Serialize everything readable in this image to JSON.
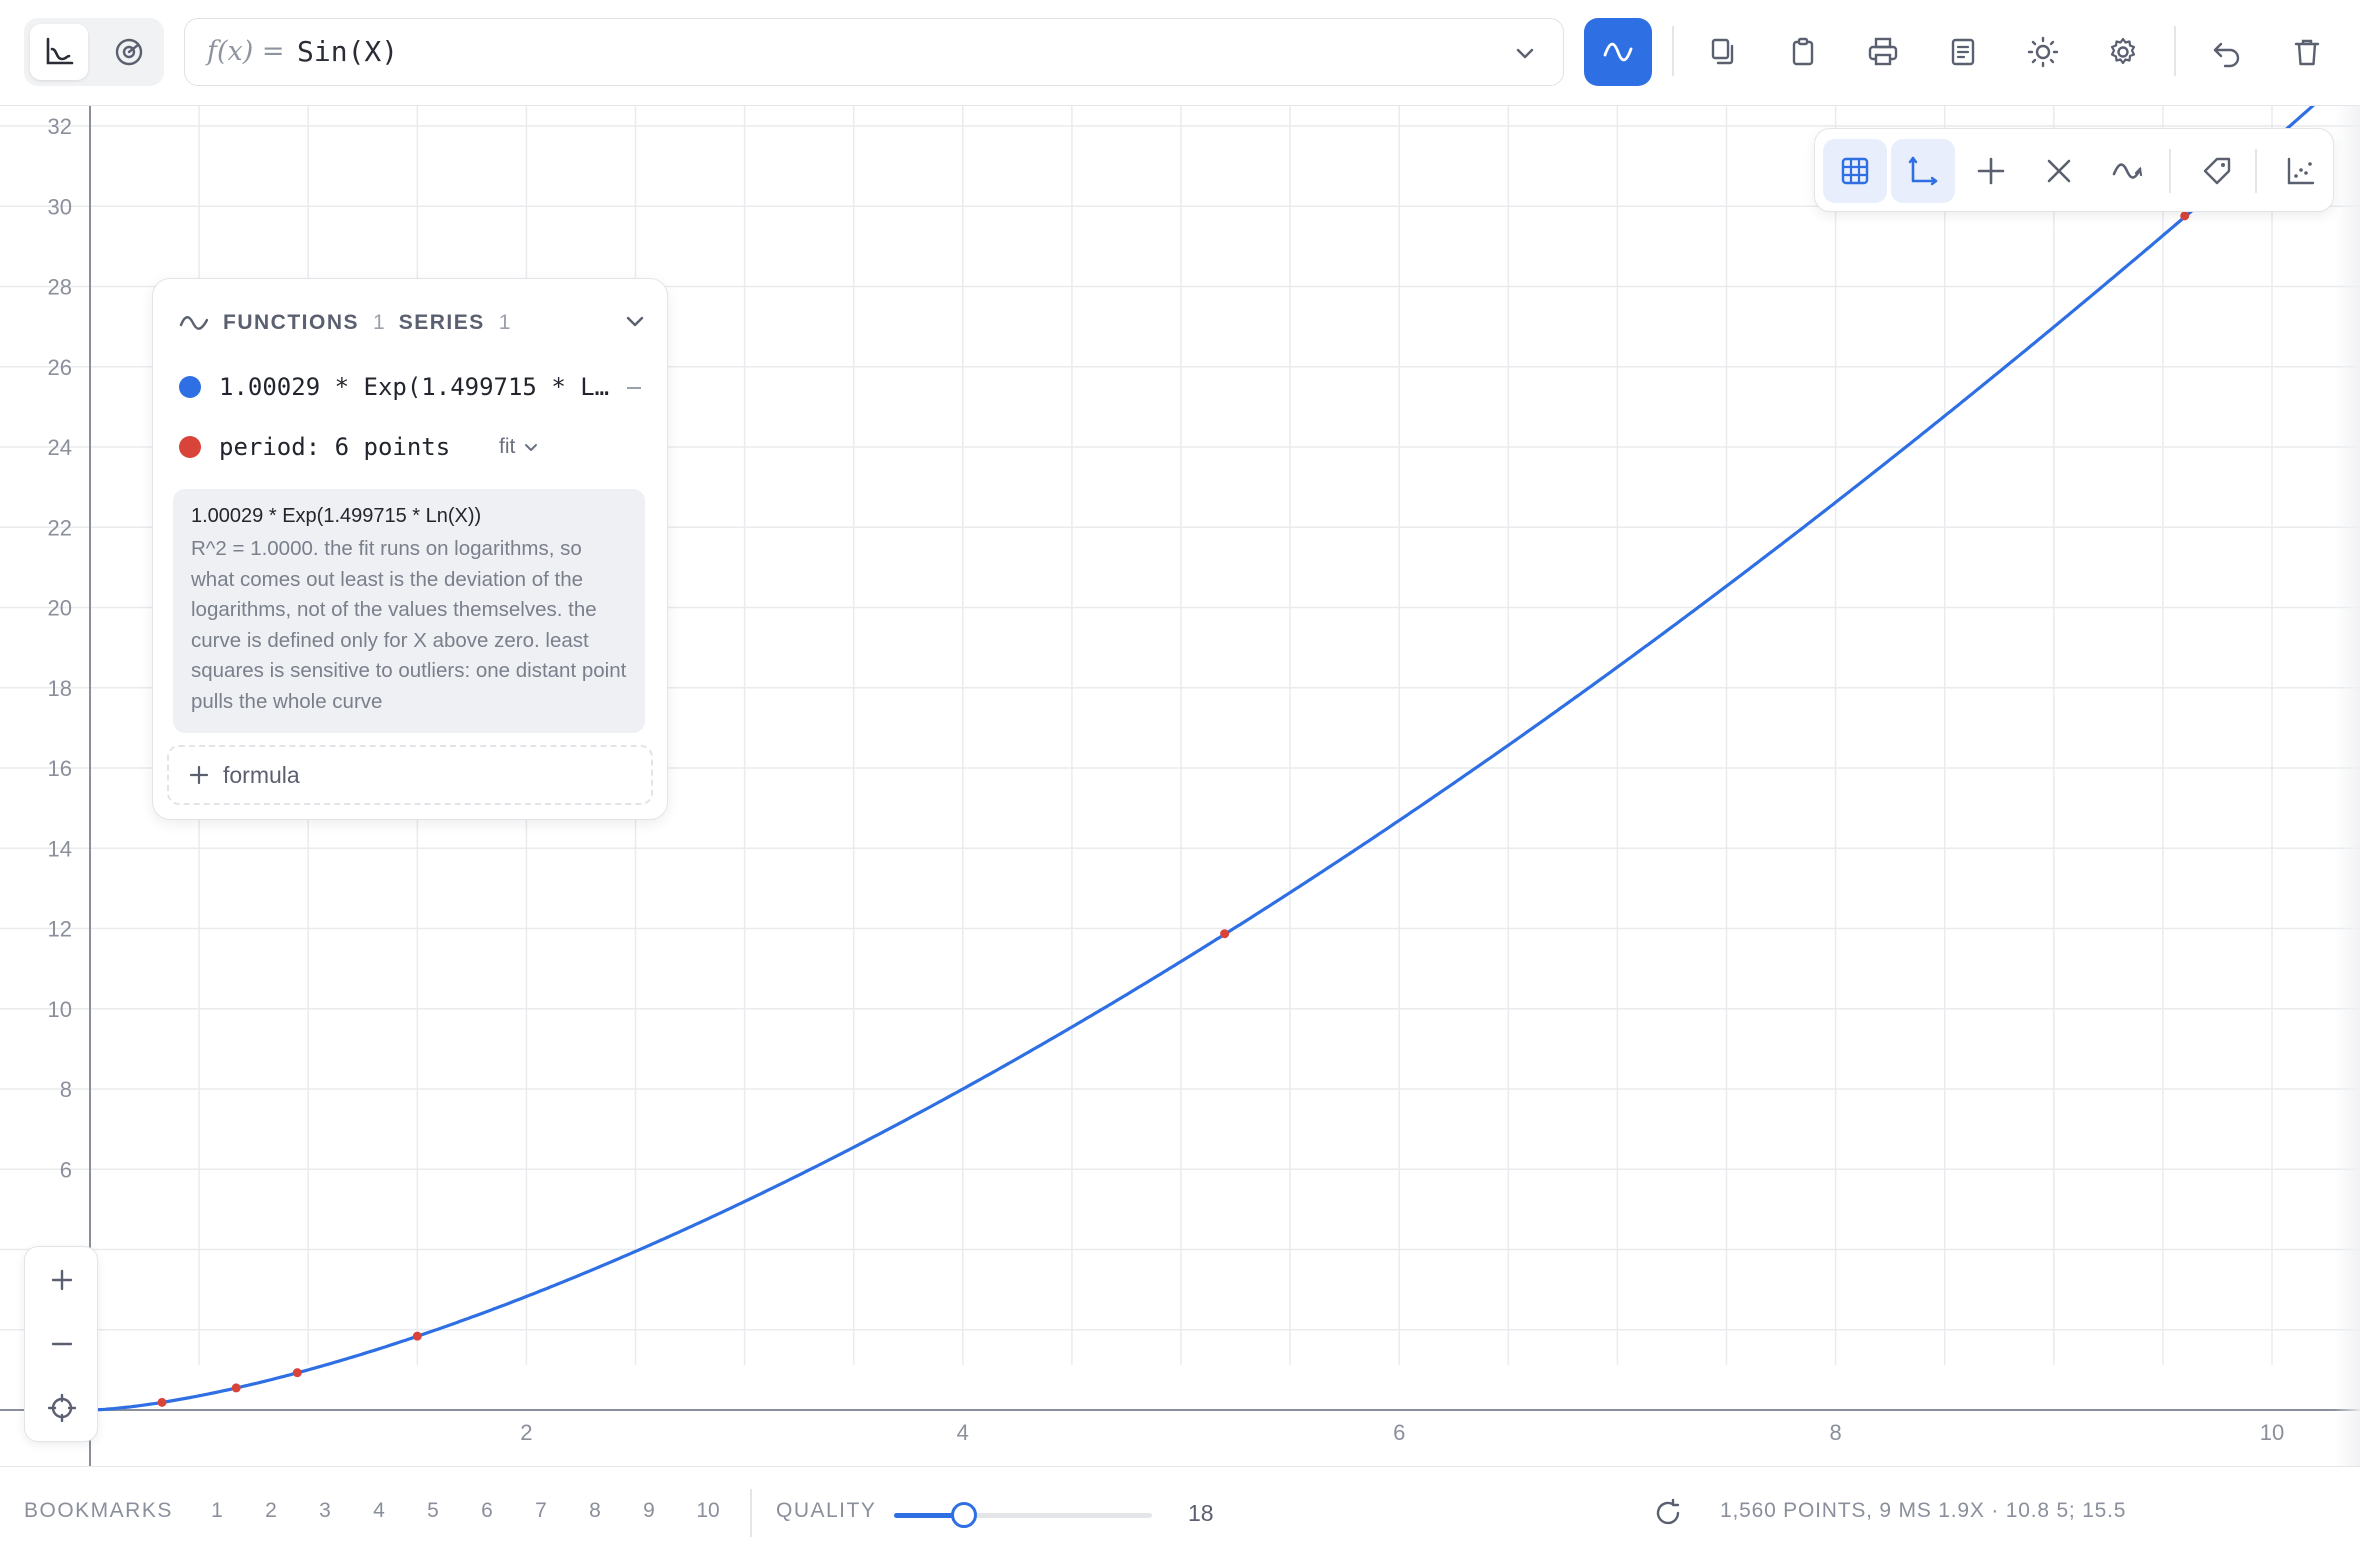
{
  "toolbar": {
    "fx_label": "f(x) =",
    "formula": "Sin(X)",
    "icons": [
      "axes-mode-icon",
      "polar-mode-icon",
      "chevron-down-icon",
      "plot-wave-icon",
      "copy-icon",
      "clipboard-icon",
      "print-icon",
      "document-icon",
      "theme-sun-icon",
      "settings-gear-icon",
      "undo-icon",
      "trash-icon"
    ]
  },
  "panel": {
    "functions_label": "FUNCTIONS",
    "functions_count": "1",
    "series_label": "SERIES",
    "series_count": "1",
    "function_item": "1.00029 * Exp(1.499715 * L…",
    "series_item": "period: 6 points",
    "fit_label": "fit",
    "info_title": "1.00029 * Exp(1.499715 * Ln(X))",
    "info_text": "R^2 = 1.0000. the fit runs on logarithms, so what comes out least is the deviation of the logarithms, not of the values themselves. the curve is defined only for X above zero. least squares is sensitive to outliers: one distant point pulls the whole curve",
    "add_formula_label": "formula"
  },
  "right_toolbar": {
    "icons": [
      "grid-icon",
      "axes-icon",
      "crosshair-plus-icon",
      "cross-x-icon",
      "wave-icon",
      "tag-icon",
      "scatter-icon"
    ]
  },
  "zoom": {
    "icons": [
      "zoom-in-icon",
      "zoom-out-icon",
      "locate-icon"
    ]
  },
  "bottom": {
    "bookmarks_label": "BOOKMARKS",
    "bookmarks": [
      "1",
      "2",
      "3",
      "4",
      "5",
      "6",
      "7",
      "8",
      "9",
      "10"
    ],
    "quality_label": "QUALITY",
    "quality_value": "18",
    "status": "1,560 POINTS, 9 MS 1.9X · 10.8 5; 15.5"
  },
  "colors": {
    "accent": "#2f6fe4",
    "curve": "#2f6fe4",
    "series_points": "#d9443a"
  },
  "chart_data": {
    "type": "line",
    "xlim": [
      -0.4,
      10.4
    ],
    "ylim": [
      -0.4,
      32.5
    ],
    "x_ticks": [
      2,
      4,
      6,
      8,
      10
    ],
    "y_ticks": [
      6,
      8,
      10,
      12,
      14,
      16,
      18,
      20,
      22,
      24,
      26,
      28,
      30,
      32
    ],
    "grid": true,
    "series": [
      {
        "type": "function",
        "function": "1.00029 * Exp(1.499715 * Ln(X))",
        "coef": 1.00029,
        "exponent": 1.499715,
        "color": "#2f6fe4"
      },
      {
        "type": "points",
        "x": [
          0.33,
          0.67,
          0.95,
          1.5,
          5.2,
          9.6
        ],
        "y": [
          0.19,
          0.55,
          0.93,
          1.84,
          11.87,
          29.76
        ],
        "color": "#d9443a"
      }
    ]
  }
}
